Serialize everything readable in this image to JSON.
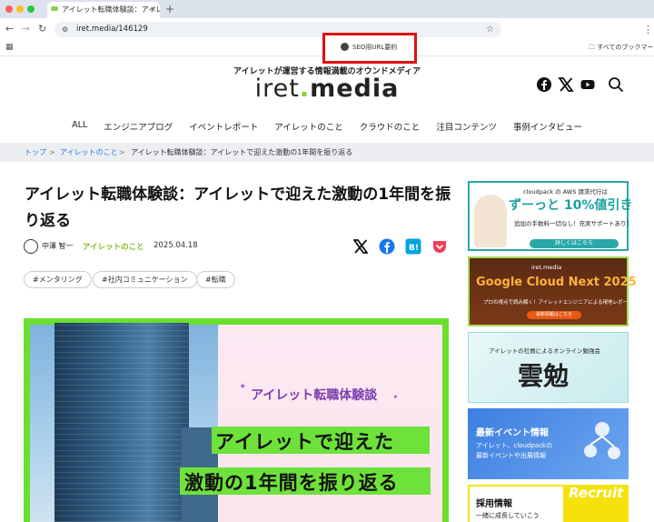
{
  "browser": {
    "tab_title": "アイレット転職体験談：アイレ",
    "tab_close": "×",
    "new_tab": "+",
    "url": "iret.media/146129",
    "star": "☆",
    "bookmarks_all": "すべてのブックマーク",
    "seo_extension_label": "SEO用URL要約"
  },
  "site": {
    "tagline": "アイレットが運営する情報満載のオウンドメディア",
    "logo_left": "iret",
    "logo_dot": ".",
    "logo_right": "media",
    "nav": [
      "ALL",
      "エンジニアブログ",
      "イベントレポート",
      "アイレットのこと",
      "クラウドのこと",
      "注目コンテンツ",
      "事例インタビュー"
    ]
  },
  "breadcrumb": {
    "home": "トップ",
    "sep": ">",
    "category": "アイレットのこと",
    "current": "アイレット転職体験談：アイレットで迎えた激動の1年間を振り返る"
  },
  "article": {
    "title": "アイレット転職体験談：アイレットで迎えた激動の1年間を振り返る",
    "author": "中澤 智一",
    "category": "アイレットのこと",
    "date": "2025.04.18",
    "tags": [
      "#メンタリング",
      "#社内コミュニケーション",
      "#転職"
    ],
    "hero_subtitle": "アイレット転職体験談",
    "hero_line1": "アイレットで迎えた",
    "hero_line2": "激動の1年間を振り返る"
  },
  "sidebar": {
    "ad1_head": "cloudpack の AWS 請求代行は",
    "ad1_big": "ずーっと 10%値引き",
    "ad1_sub": "追加の手数料一切なし！充実サポートあり！",
    "ad1_button": "詳しくはこちら",
    "ad2_head": "iret.media",
    "ad2_big": "Google Cloud Next 2025",
    "ad2_sub": "プロの視点で読み解く！アイレットエンジニアによる現地レポート！",
    "ad2_button": "最新情報はこちら",
    "ad3_head": "アイレットの社員によるオンライン勉強会",
    "ad3_big": "雲勉",
    "ad4_head": "最新イベント情報",
    "ad4_sub1": "アイレット、cloudpackの",
    "ad4_sub2": "最新イベントや出展情報",
    "ad5_head": "採用情報",
    "ad5_recruit": "Recruit",
    "ad5_sub": "一緒に成長していこう"
  },
  "colors": {
    "accent_green": "#8ed12b",
    "seo_highlight": "#e01010"
  }
}
